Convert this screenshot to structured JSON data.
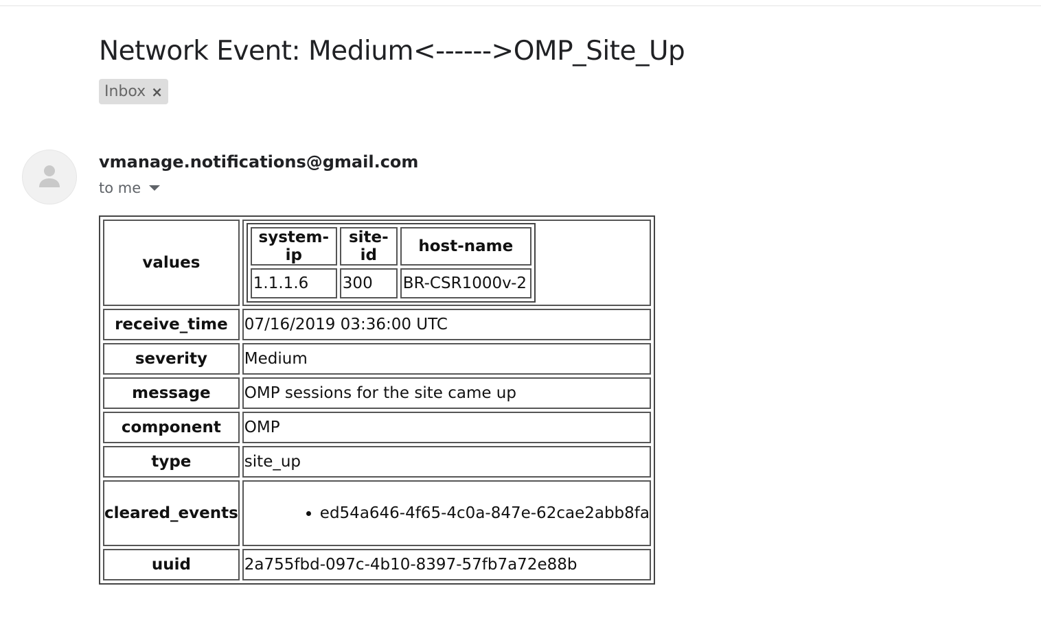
{
  "email": {
    "subject": "Network Event: Medium<------>OMP_Site_Up",
    "label": "Inbox",
    "label_remove": "×",
    "sender": "vmanage.notifications@gmail.com",
    "recipient": "to me"
  },
  "event_table": {
    "values_key": "values",
    "values_table": {
      "headers": [
        "system-ip",
        "site-id",
        "host-name"
      ],
      "row": [
        "1.1.1.6",
        "300",
        "BR-CSR1000v-2"
      ]
    },
    "rows": [
      {
        "key": "receive_time",
        "value": "07/16/2019 03:36:00 UTC"
      },
      {
        "key": "severity",
        "value": "Medium"
      },
      {
        "key": "message",
        "value": "OMP sessions for the site came up"
      },
      {
        "key": "component",
        "value": "OMP"
      },
      {
        "key": "type",
        "value": "site_up"
      }
    ],
    "cleared_events_key": "cleared_events",
    "cleared_events": [
      "ed54a646-4f65-4c0a-847e-62cae2abb8fa"
    ],
    "uuid_key": "uuid",
    "uuid_value": "2a755fbd-097c-4b10-8397-57fb7a72e88b"
  },
  "icons": {
    "avatar": "person-silhouette-icon",
    "recipient_details": "caret-down-icon",
    "label_remove": "close-icon"
  },
  "colors": {
    "label_chip_bg": "#dddddd",
    "table_border": "#555555",
    "secondary_text": "#5f6368"
  }
}
